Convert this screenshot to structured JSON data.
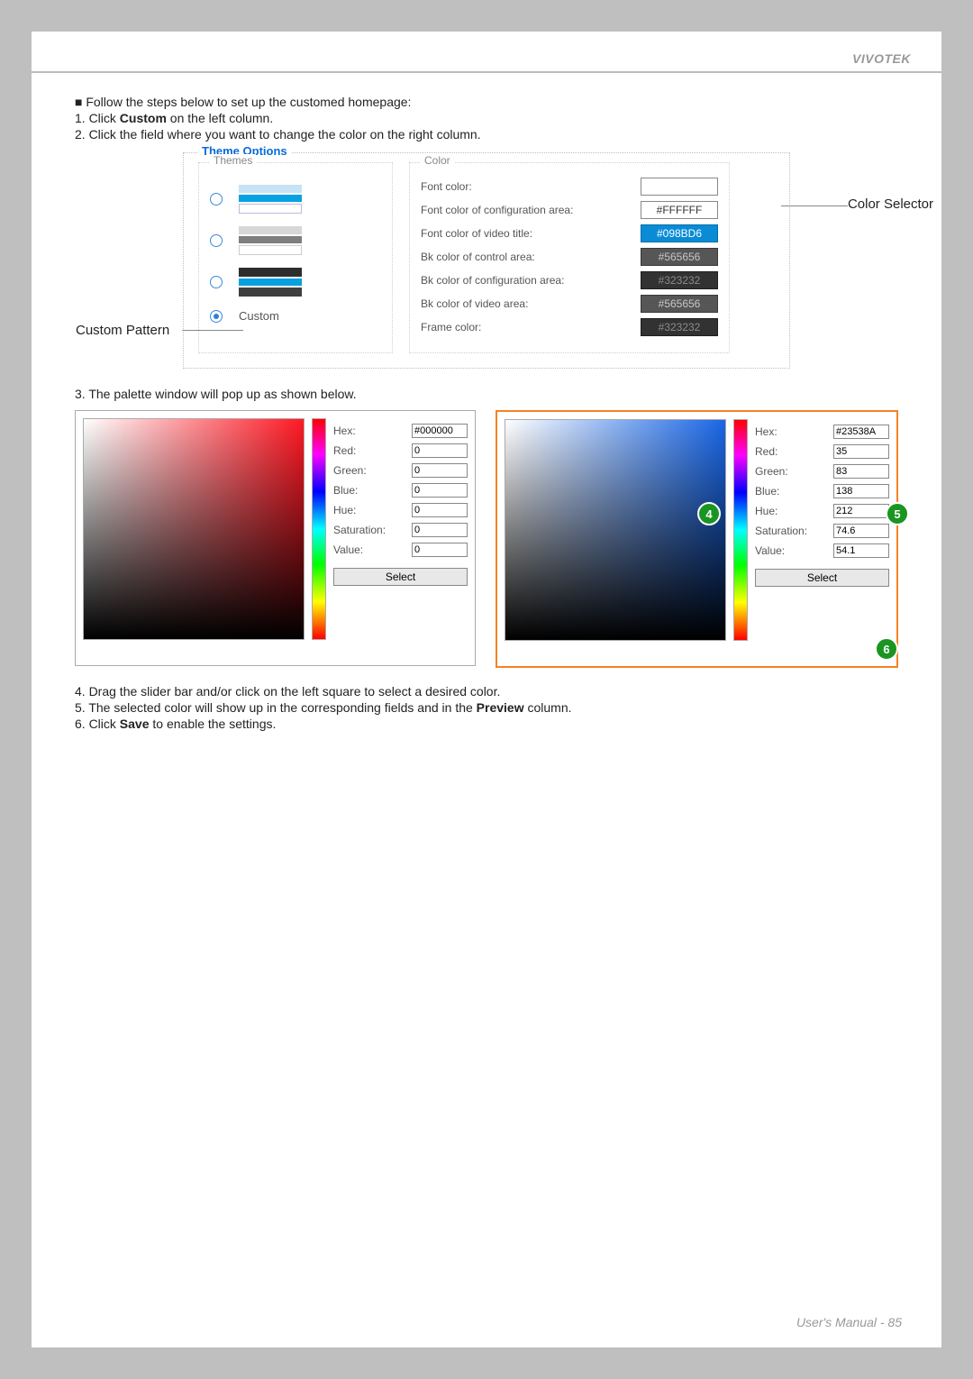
{
  "brand": "VIVOTEK",
  "intro": "■ Follow the steps below to set up the customed homepage:",
  "steps": {
    "s1a": "1. Click ",
    "s1b": "Custom",
    "s1c": " on the left column.",
    "s2": "2. Click the field where you want to change the color on the right column.",
    "s3": "3. The palette window will pop up as shown below.",
    "s4": "4. Drag the slider bar and/or click on the left square to select a desired color.",
    "s5a": "5. The selected color will show up in the corresponding fields and in the ",
    "s5b": "Preview",
    "s5c": " column.",
    "s6a": "6. Click ",
    "s6b": "Save",
    "s6c": " to enable the settings."
  },
  "panel": {
    "legend": "Theme Options",
    "themes_label": "Themes",
    "color_label": "Color",
    "custom_label": "Custom",
    "rows": {
      "font_color": "Font color:",
      "font_config": "Font color of configuration area:",
      "font_video_title": "Font color of video title:",
      "bk_control": "Bk color of control area:",
      "bk_config": "Bk color of configuration area:",
      "bk_video": "Bk color of video area:",
      "frame_color": "Frame color:"
    },
    "values": {
      "font_config": "#FFFFFF",
      "font_video_title": "#098BD6",
      "bk_control": "#565656",
      "bk_config": "#323232",
      "bk_video": "#565656",
      "frame_color": "#323232"
    }
  },
  "callouts": {
    "custom": "Custom Pattern",
    "selector": "Color Selector"
  },
  "palette": {
    "labels": {
      "hex": "Hex:",
      "red": "Red:",
      "green": "Green:",
      "blue": "Blue:",
      "hue": "Hue:",
      "sat": "Saturation:",
      "val": "Value:",
      "select": "Select"
    },
    "left": {
      "hex": "#000000",
      "red": "0",
      "green": "0",
      "blue": "0",
      "hue": "0",
      "sat": "0",
      "val": "0"
    },
    "right": {
      "hex": "#23538A",
      "red": "35",
      "green": "83",
      "blue": "138",
      "hue": "212",
      "sat": "74.6",
      "val": "54.1"
    }
  },
  "bubbles": {
    "b4": "4",
    "b5": "5",
    "b6": "6"
  },
  "footer": "User's Manual - 85"
}
